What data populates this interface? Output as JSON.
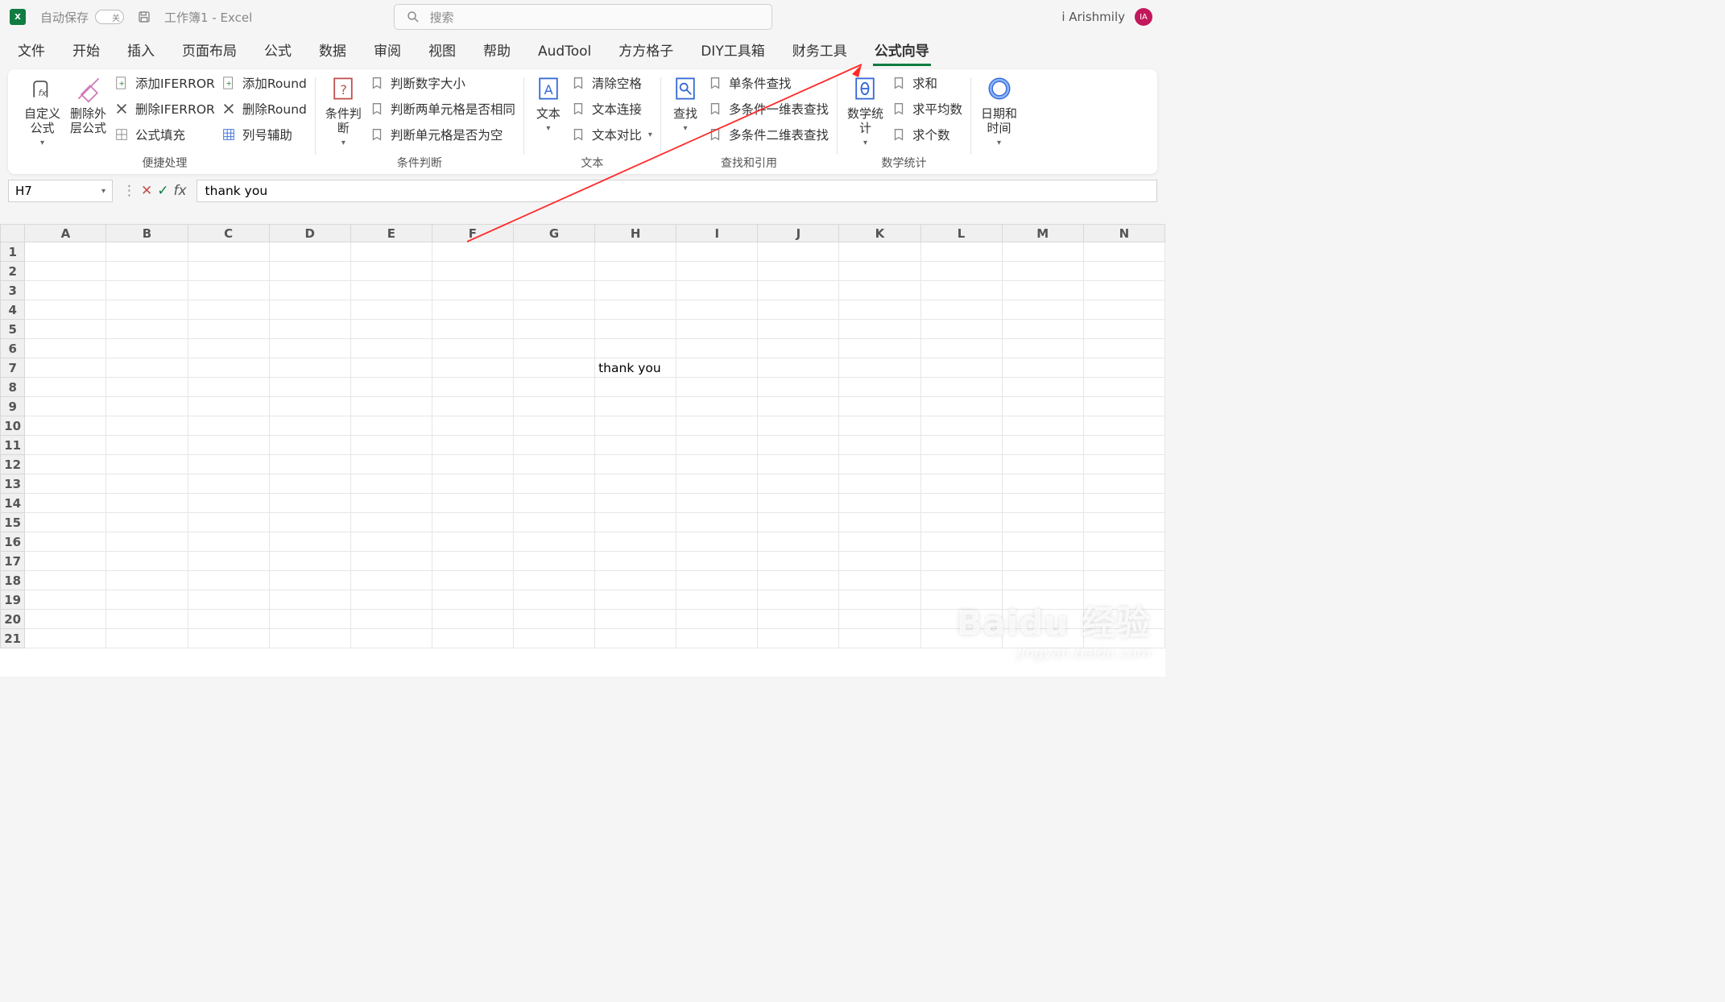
{
  "title": {
    "autosave": "自动保存",
    "autosave_state": "关",
    "docname": "工作簿1  -  Excel"
  },
  "search": {
    "placeholder": "搜索"
  },
  "user": {
    "name": "i Arishmily",
    "initials": "IA"
  },
  "tabs": [
    "文件",
    "开始",
    "插入",
    "页面布局",
    "公式",
    "数据",
    "审阅",
    "视图",
    "帮助",
    "AudTool",
    "方方格子",
    "DIY工具箱",
    "财务工具",
    "公式向导"
  ],
  "active_tab_index": 13,
  "ribbon": {
    "g1": {
      "big1": "自定义\n公式",
      "big2": "删除外\n层公式",
      "c1": "添加IFERROR",
      "c2": "删除IFERROR",
      "c3": "公式填充",
      "c4": "添加Round",
      "c5": "删除Round",
      "c6": "列号辅助",
      "label": "便捷处理"
    },
    "g2": {
      "big": "条件判\n断",
      "c1": "判断数字大小",
      "c2": "判断两单元格是否相同",
      "c3": "判断单元格是否为空",
      "label": "条件判断"
    },
    "g3": {
      "big": "文本",
      "c1": "清除空格",
      "c2": "文本连接",
      "c3": "文本对比",
      "label": "文本"
    },
    "g4": {
      "big": "查找",
      "c1": "单条件查找",
      "c2": "多条件一维表查找",
      "c3": "多条件二维表查找",
      "label": "查找和引用"
    },
    "g5": {
      "big": "数学统\n计",
      "c1": "求和",
      "c2": "求平均数",
      "c3": "求个数",
      "label": "数学统计"
    },
    "g6": {
      "big": "日期和\n时间"
    }
  },
  "namebox": "H7",
  "formula": "thank you",
  "columns": [
    "A",
    "B",
    "C",
    "D",
    "E",
    "F",
    "G",
    "H",
    "I",
    "J",
    "K",
    "L",
    "M",
    "N"
  ],
  "rows": [
    "1",
    "2",
    "3",
    "4",
    "5",
    "6",
    "7",
    "8",
    "9",
    "10",
    "11",
    "12",
    "13",
    "14",
    "15",
    "16",
    "17",
    "18",
    "19",
    "20",
    "21"
  ],
  "cell_value": "thank you",
  "cell_row": 6,
  "cell_col": 7,
  "watermark": {
    "brand": "Baidu 经验",
    "url": "jingyan.baidu.com"
  }
}
